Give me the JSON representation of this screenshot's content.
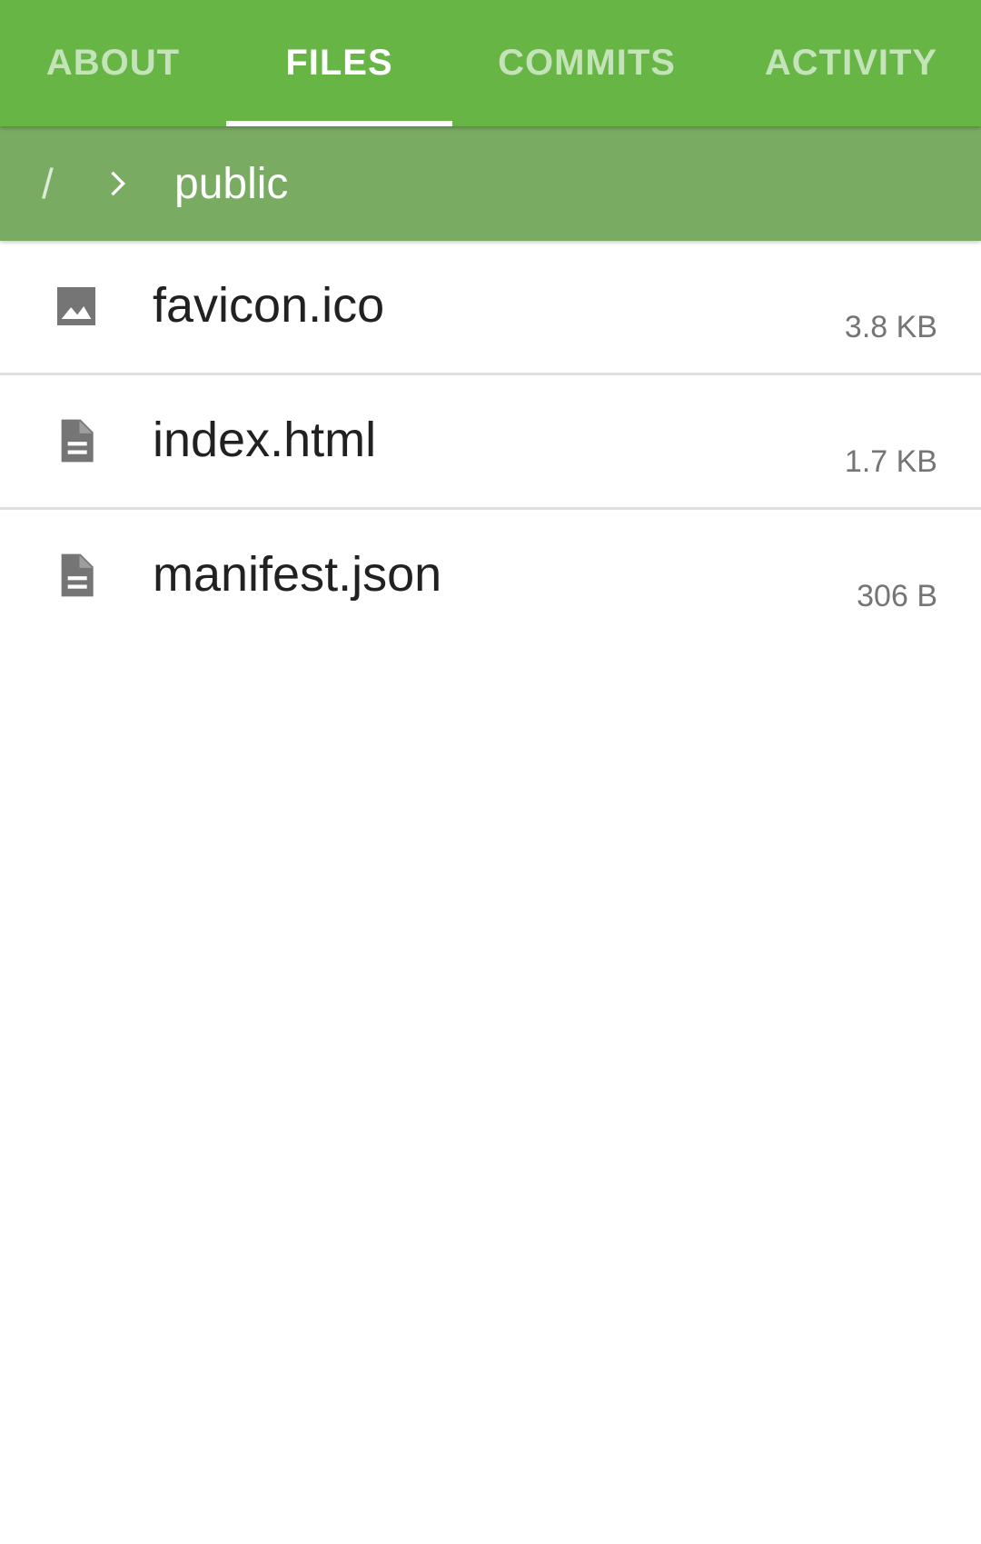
{
  "tabs": [
    {
      "label": "ABOUT",
      "active": false
    },
    {
      "label": "FILES",
      "active": true
    },
    {
      "label": "COMMITS",
      "active": false
    },
    {
      "label": "ACTIVITY",
      "active": false
    }
  ],
  "breadcrumb": {
    "root": "/",
    "separator_icon": "chevron-right-icon",
    "current": "public"
  },
  "files": [
    {
      "name": "favicon.ico",
      "size": "3.8 KB",
      "icon": "image-icon"
    },
    {
      "name": "index.html",
      "size": "1.7 KB",
      "icon": "document-icon"
    },
    {
      "name": "manifest.json",
      "size": "306 B",
      "icon": "document-icon"
    }
  ],
  "colors": {
    "tab_bar": "#66b545",
    "breadcrumb_bar": "#7aab63",
    "icon": "#757575",
    "text": "#212121",
    "divider": "#e0e0e0"
  }
}
